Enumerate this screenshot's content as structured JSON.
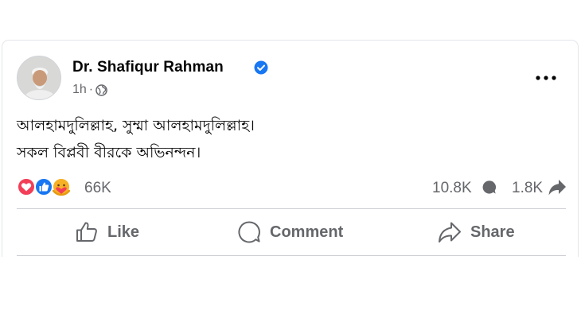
{
  "post": {
    "author": "Dr. Shafiqur Rahman",
    "time": "1h",
    "separator": "·",
    "lines": [
      "আলহামদুলিল্লাহ, সুম্মা আলহামদুলিল্লাহ।",
      "সকল বিপ্লবী বীরকে অভিনন্দন।"
    ]
  },
  "stats": {
    "reactions": "66K",
    "comments": "10.8K",
    "shares": "1.8K"
  },
  "actions": {
    "like": "Like",
    "comment": "Comment",
    "share": "Share"
  },
  "icons": {
    "verified": "verified-badge-icon",
    "privacy": "globe-icon",
    "more": "more-options-icon",
    "reactions": [
      "love-reaction-icon",
      "like-reaction-icon",
      "care-reaction-icon"
    ]
  },
  "colors": {
    "accent": "#1877f2",
    "love": "#f33e58",
    "care": "#f7b125",
    "muted": "#65676b"
  }
}
